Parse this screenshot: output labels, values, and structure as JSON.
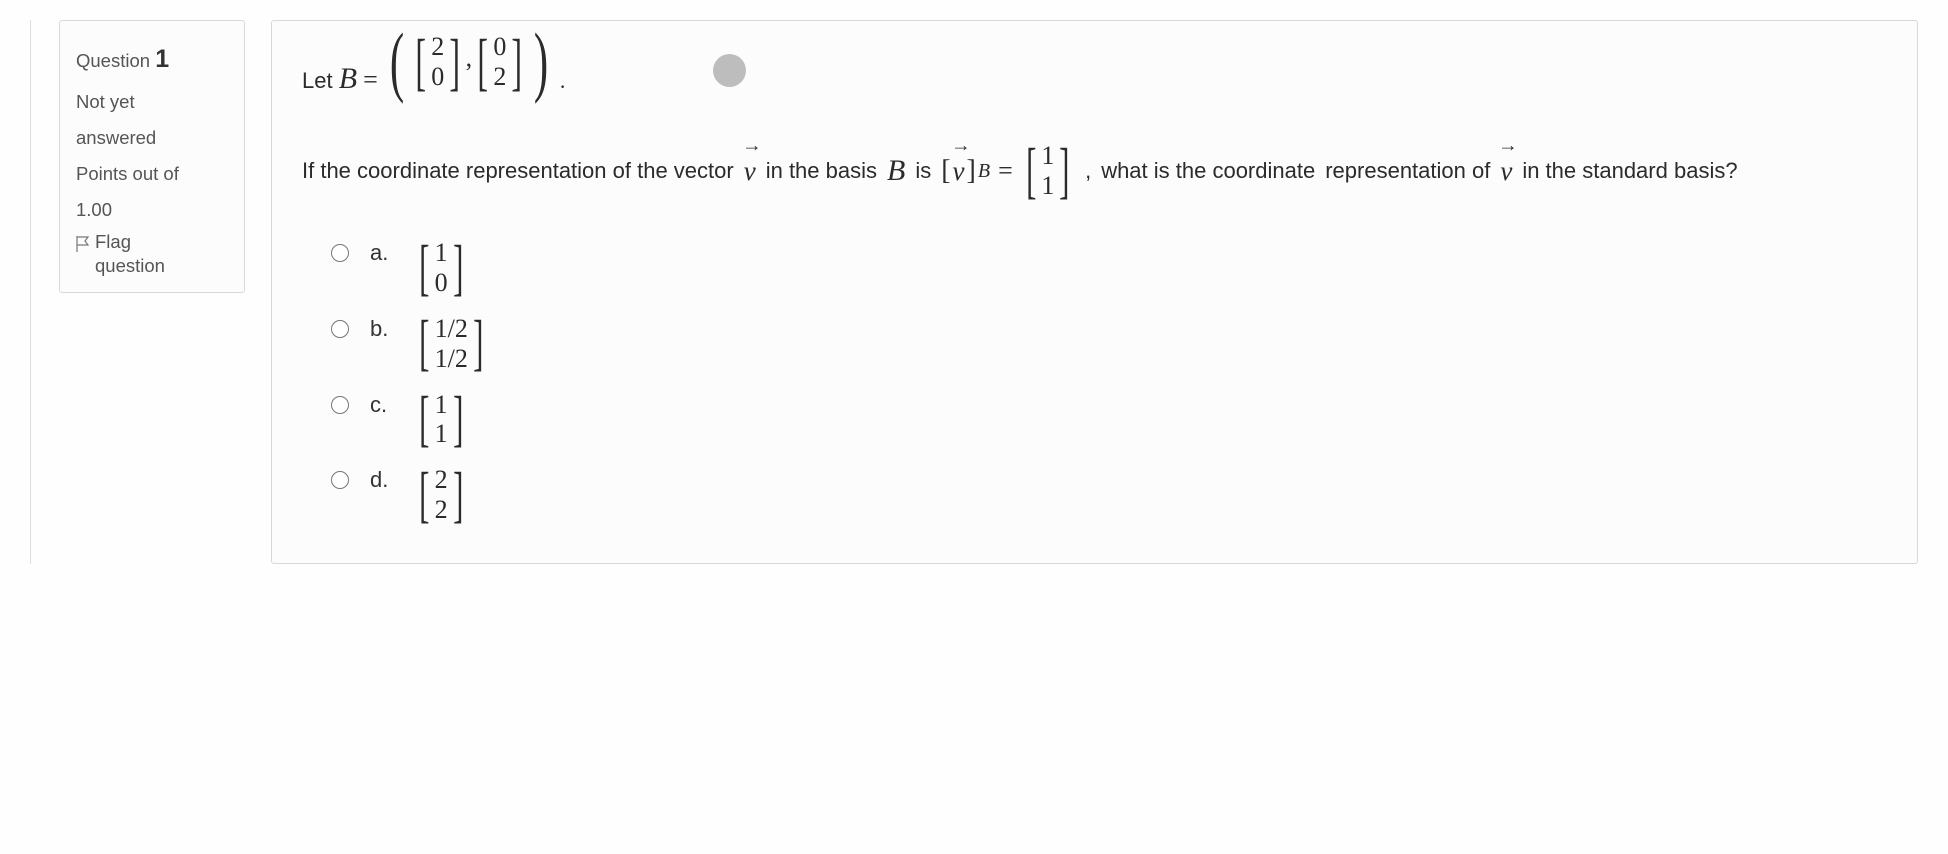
{
  "info": {
    "question_label": "Question",
    "question_number": "1",
    "status_line1": "Not yet",
    "status_line2": "answered",
    "points_label": "Points out of",
    "points_value": "1.00",
    "flag_line1": "Flag",
    "flag_line2": "question"
  },
  "question": {
    "let_label": "Let",
    "basis_symbol": "B",
    "equals": "=",
    "basis_vectors": [
      {
        "top": "2",
        "bottom": "0"
      },
      {
        "top": "0",
        "bottom": "2"
      }
    ],
    "period": ".",
    "line2_a": "If the coordinate representation of the vector",
    "vec_letter": "v",
    "line2_b": "in the basis",
    "line2_c": "is",
    "coord_symbol_open": "[",
    "coord_symbol_close": "]",
    "coord_vector": {
      "top": "1",
      "bottom": "1"
    },
    "comma": ",",
    "line2_d": "what is the coordinate",
    "line3": "representation of",
    "line3_b": "in the standard basis?"
  },
  "answers": [
    {
      "letter": "a.",
      "top": "1",
      "bottom": "0"
    },
    {
      "letter": "b.",
      "top": "1/2",
      "bottom": "1/2"
    },
    {
      "letter": "c.",
      "top": "1",
      "bottom": "1"
    },
    {
      "letter": "d.",
      "top": "2",
      "bottom": "2"
    }
  ]
}
